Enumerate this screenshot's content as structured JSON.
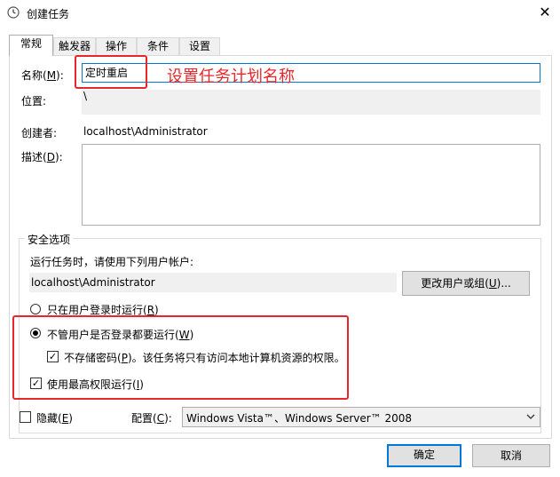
{
  "window": {
    "title": "创建任务",
    "close_label": "✕"
  },
  "tabs": [
    {
      "label": "常规",
      "active": true
    },
    {
      "label": "触发器"
    },
    {
      "label": "操作"
    },
    {
      "label": "条件"
    },
    {
      "label": "设置"
    }
  ],
  "general": {
    "name_label_pre": "名称(",
    "name_label_key": "M",
    "name_label_post": "):",
    "name_value": "定时重启",
    "annotation": "设置任务计划名称",
    "location_label": "位置:",
    "location_value": "\\",
    "author_label": "创建者:",
    "author_value": "localhost\\Administrator",
    "desc_label_pre": "描述(",
    "desc_label_key": "D",
    "desc_label_post": "):",
    "desc_value": ""
  },
  "security": {
    "group_title": "安全选项",
    "run_as_text": "运行任务时，请使用下列用户帐户:",
    "user_value": "localhost\\Administrator",
    "change_user_button_pre": "更改用户或组(",
    "change_user_button_key": "U",
    "change_user_button_post": ")...",
    "radio_logged_on_pre": "只在用户登录时运行(",
    "radio_logged_on_key": "R",
    "radio_logged_on_post": ")",
    "radio_whether_pre": "不管用户是否登录都要运行(",
    "radio_whether_key": "W",
    "radio_whether_post": ")",
    "no_store_pw_pre": "不存储密码(",
    "no_store_pw_key": "P",
    "no_store_pw_post": ")。该任务将只有访问本地计算机资源的权限。",
    "highest_priv_pre": "使用最高权限运行(",
    "highest_priv_key": "I",
    "highest_priv_post": ")"
  },
  "bottom": {
    "hidden_pre": "隐藏(",
    "hidden_key": "E",
    "hidden_post": ")",
    "config_pre": "配置(",
    "config_key": "C",
    "config_post": "):",
    "config_value": "Windows Vista™、Windows Server™ 2008",
    "ok_label": "确定",
    "cancel_label": "取消"
  },
  "colors": {
    "accent": "#0078d7",
    "annotation_red": "#e8262b"
  },
  "icons": {
    "window": "clock-icon",
    "dropdown": "chevron-down-icon"
  }
}
